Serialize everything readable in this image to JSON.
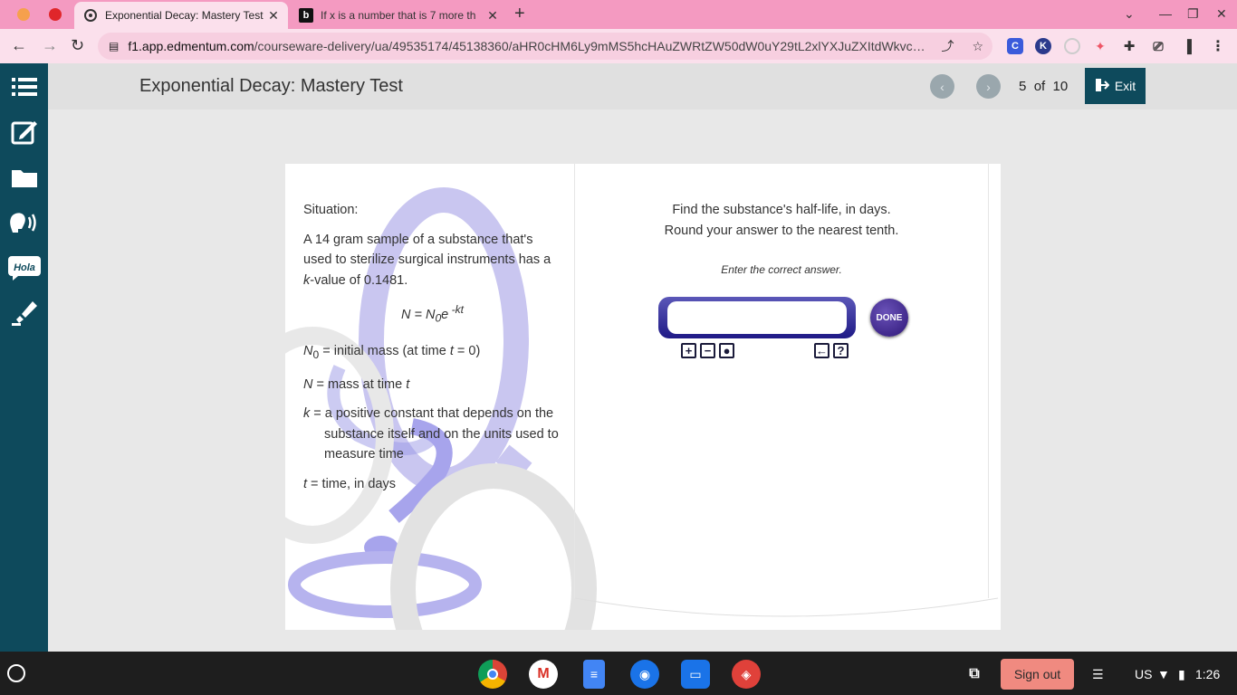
{
  "browser": {
    "tabs": [
      {
        "title": "Exponential Decay: Mastery Test",
        "active": true
      },
      {
        "title": "If x is a number that is 7 more th",
        "active": false
      }
    ],
    "url_host": "f1.app.edmentum.com",
    "url_path": "/courseware-delivery/ua/49535174/45138360/aHR0cHM6Ly9mMS5hcHAuZWRtZW50dW0uY29tL2xlYXJuZXItdWkvc…"
  },
  "header": {
    "title": "Exponential Decay: Mastery Test",
    "current": "5",
    "of_label": "of",
    "total": "10",
    "exit_label": "Exit"
  },
  "situation": {
    "heading": "Situation:",
    "body_pre": "A 14 gram sample of a substance that's used to sterilize surgical instruments has a ",
    "k_var": "k",
    "body_post": "-value of 0.1481.",
    "formula_lhs": "N = N",
    "formula_sub": "0",
    "formula_e": "e",
    "formula_sup": " -kt",
    "defs": {
      "n0_var": "N",
      "n0_sub": "0",
      "n0_text": " = initial mass (at time ",
      "n0_t": "t",
      "n0_end": " = 0)",
      "n_var": "N",
      "n_text": " = mass at time ",
      "n_t": "t",
      "k_var": "k",
      "k_text": " = a positive constant that depends on the substance itself and on the units used to measure time",
      "t_var": "t",
      "t_text": " = time, in days"
    }
  },
  "question": {
    "line1": "Find the substance's half-life, in days.",
    "line2": "Round your answer to the nearest tenth.",
    "instruction": "Enter the correct answer.",
    "answer_value": "",
    "done_label": "DONE"
  },
  "taskbar": {
    "signout_label": "Sign out",
    "locale": "US",
    "time": "1:26"
  },
  "colors": {
    "tabstrip": "#f49ac1",
    "sidebar": "#0e4a5c",
    "exit_button": "#0e4a5c",
    "done_button": "#3b2390"
  }
}
